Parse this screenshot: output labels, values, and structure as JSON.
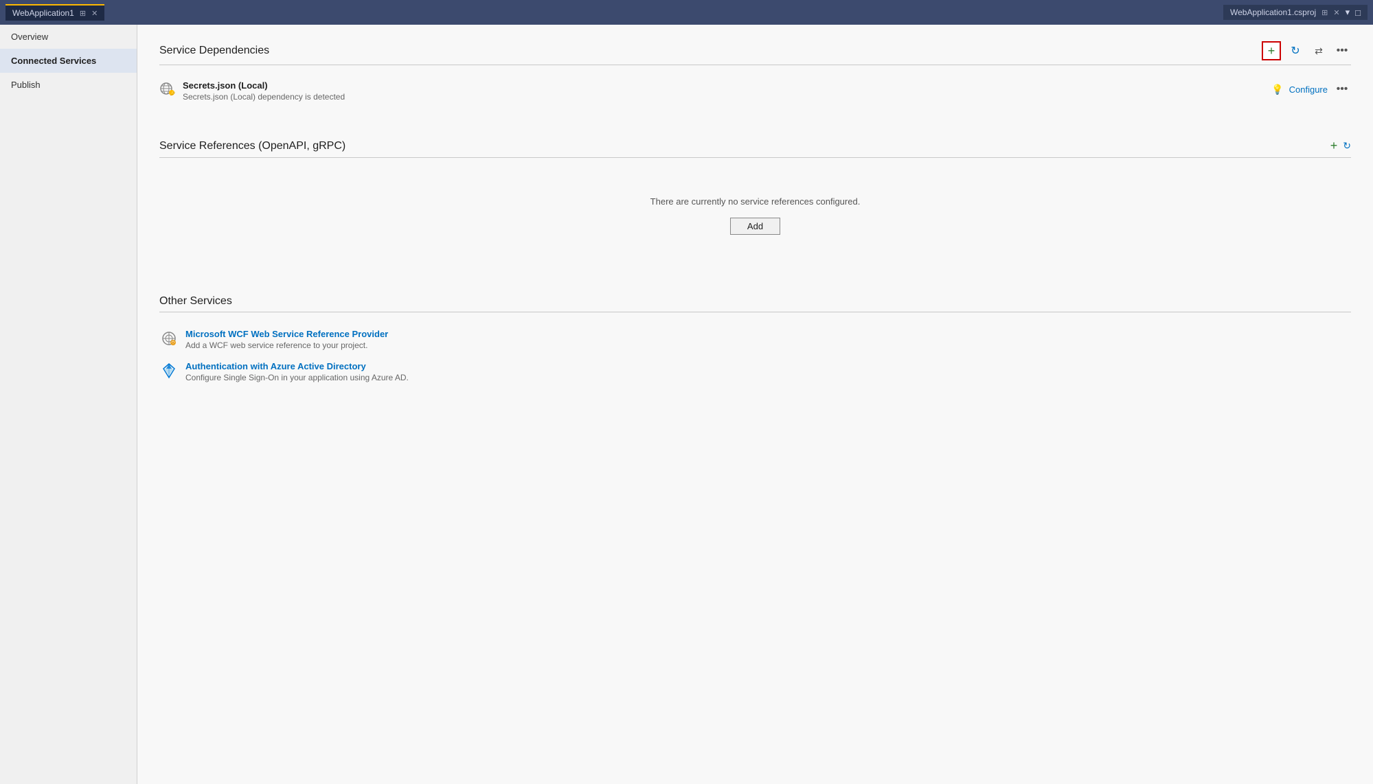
{
  "titlebar": {
    "tab_label": "WebApplication1",
    "tab_pin": "📌",
    "tab_close": "✕",
    "project_name": "WebApplication1.csproj",
    "proj_pin": "📌",
    "proj_close": "✕",
    "chevron_down": "▾",
    "maximize": "□"
  },
  "sidebar": {
    "items": [
      {
        "id": "overview",
        "label": "Overview",
        "active": false
      },
      {
        "id": "connected-services",
        "label": "Connected Services",
        "active": true
      },
      {
        "id": "publish",
        "label": "Publish",
        "active": false
      }
    ]
  },
  "service_dependencies": {
    "title": "Service Dependencies",
    "dependency": {
      "name": "Secrets.json (Local)",
      "description": "Secrets.json (Local) dependency is detected",
      "configure_label": "Configure"
    }
  },
  "service_references": {
    "title": "Service References (OpenAPI, gRPC)",
    "empty_text": "There are currently no service references configured.",
    "add_button_label": "Add"
  },
  "other_services": {
    "title": "Other Services",
    "items": [
      {
        "name": "Microsoft WCF Web Service Reference Provider",
        "description": "Add a WCF web service reference to your project."
      },
      {
        "name": "Authentication with Azure Active Directory",
        "description": "Configure Single Sign-On in your application using Azure AD."
      }
    ]
  },
  "icons": {
    "add_plus": "+",
    "refresh": "↻",
    "share": "⇄",
    "more_dots": "•••",
    "bulb": "💡",
    "green_plus": "+",
    "section_refresh": "↻",
    "chevron_down": "▾"
  }
}
